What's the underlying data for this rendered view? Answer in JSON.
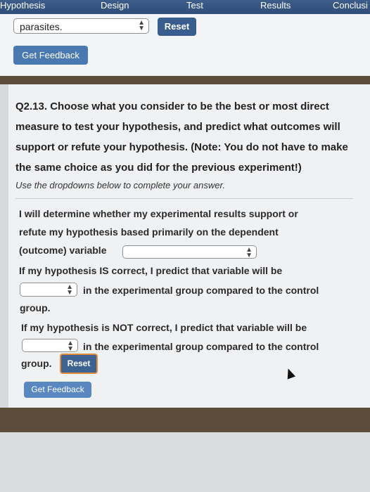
{
  "tabs": [
    "Hypothesis",
    "Design",
    "Test",
    "Results",
    "Conclusi"
  ],
  "top": {
    "select_value": "parasites.",
    "reset_label": "Reset",
    "feedback_label": "Get Feedback"
  },
  "question": {
    "text": "Q2.13. Choose what you consider to be the best or most direct measure to test your hypothesis, and predict what outcomes will support or refute your hypothesis. (Note: You do not have to make the same choice as you did for the previous experiment!)",
    "instruction": "Use the dropdowns below to complete your answer.",
    "line1": "I will determine whether my experimental results support or",
    "line2": "refute my hypothesis based primarily on the dependent",
    "line3": "(outcome) variable",
    "line4": "If my hypothesis IS correct, I predict that variable will be",
    "line5": "in the experimental group compared to the control",
    "line6": "group.",
    "line7": "If my hypothesis is NOT correct, I predict that variable will be",
    "line8": "in the experimental group compared to the control",
    "line9": "group.",
    "variable_value": "",
    "correct_value": "",
    "notcorrect_value": "",
    "reset_label": "Reset",
    "feedback_label": "Get Feedback"
  }
}
